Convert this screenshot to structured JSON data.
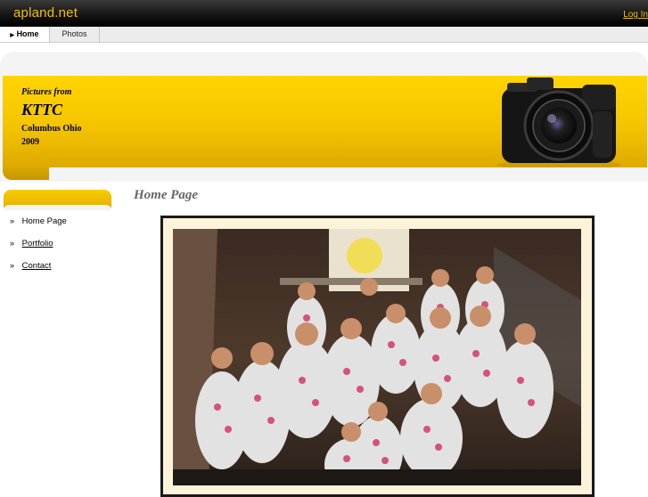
{
  "topbar": {
    "brand": "apland.net",
    "login": "Log In"
  },
  "tabs": [
    {
      "label": "Home",
      "active": true
    },
    {
      "label": "Photos",
      "active": false
    }
  ],
  "banner": {
    "pre": "Pictures from",
    "title": "KTTC",
    "line1": "Columbus Ohio",
    "line2": "2009"
  },
  "sidebar": {
    "items": [
      {
        "label": "Home Page",
        "link": false
      },
      {
        "label": "Portfolio",
        "link": true
      },
      {
        "label": "Contact",
        "link": true
      }
    ]
  },
  "main": {
    "title": "Home Page"
  },
  "colors": {
    "accent": "#f5c400",
    "topbar": "#111111"
  },
  "icons": {
    "camera": "camera-icon",
    "photo": "group-photo"
  }
}
